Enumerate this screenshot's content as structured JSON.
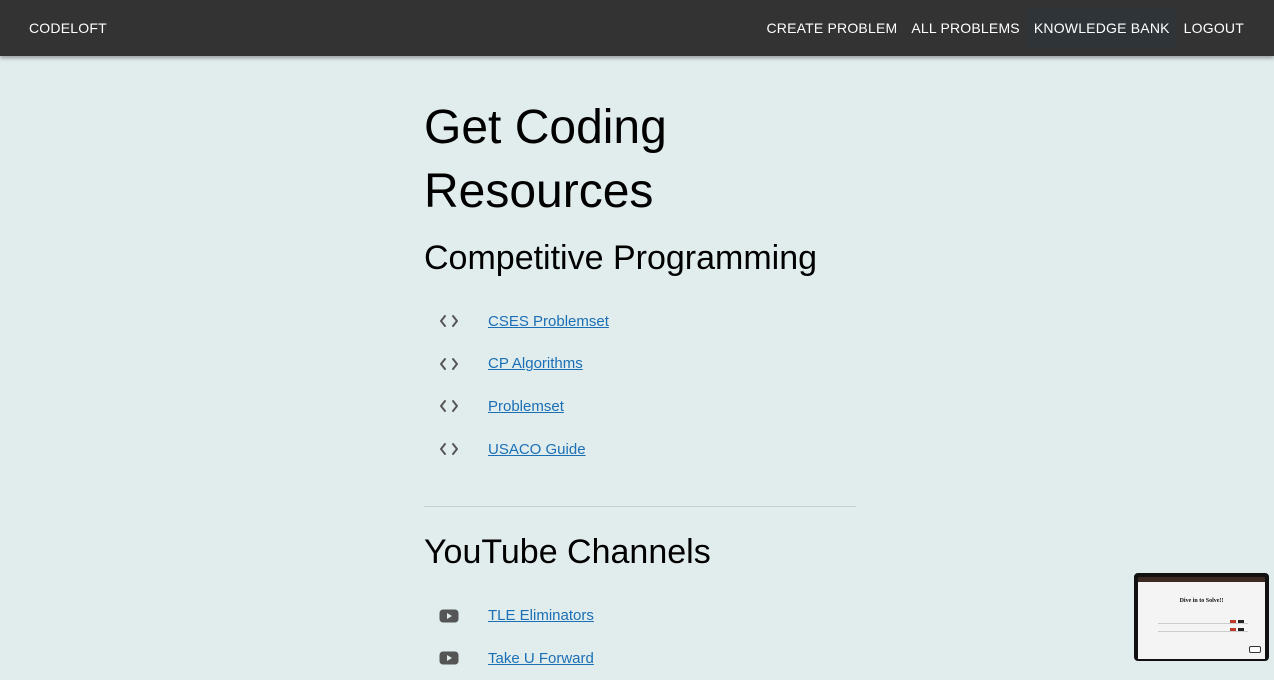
{
  "navbar": {
    "brand": "CODELOFT",
    "links": [
      {
        "label": "CREATE PROBLEM",
        "icon": ""
      },
      {
        "label": "ALL PROBLEMS",
        "icon": ""
      },
      {
        "label": "KNOWLEDGE BANK",
        "icon": "",
        "active": true
      },
      {
        "label": "LOGOUT",
        "icon": ""
      }
    ]
  },
  "main": {
    "title": "Get Coding Resources",
    "sections": [
      {
        "title": "Competitive Programming",
        "icon": "code-icon",
        "items": [
          {
            "label": "CSES Problemset"
          },
          {
            "label": "CP Algorithms"
          },
          {
            "label": "Problemset"
          },
          {
            "label": "USACO Guide"
          }
        ]
      },
      {
        "title": "YouTube Channels",
        "icon": "youtube-icon",
        "items": [
          {
            "label": "TLE Eliminators"
          },
          {
            "label": "Take U Forward"
          }
        ]
      }
    ]
  },
  "preview": {
    "title": "Dive in to Solve!!"
  },
  "colors": {
    "background": "#e1eced",
    "navbar": "#333333",
    "link": "#1a6fb5",
    "icon": "#555555"
  }
}
